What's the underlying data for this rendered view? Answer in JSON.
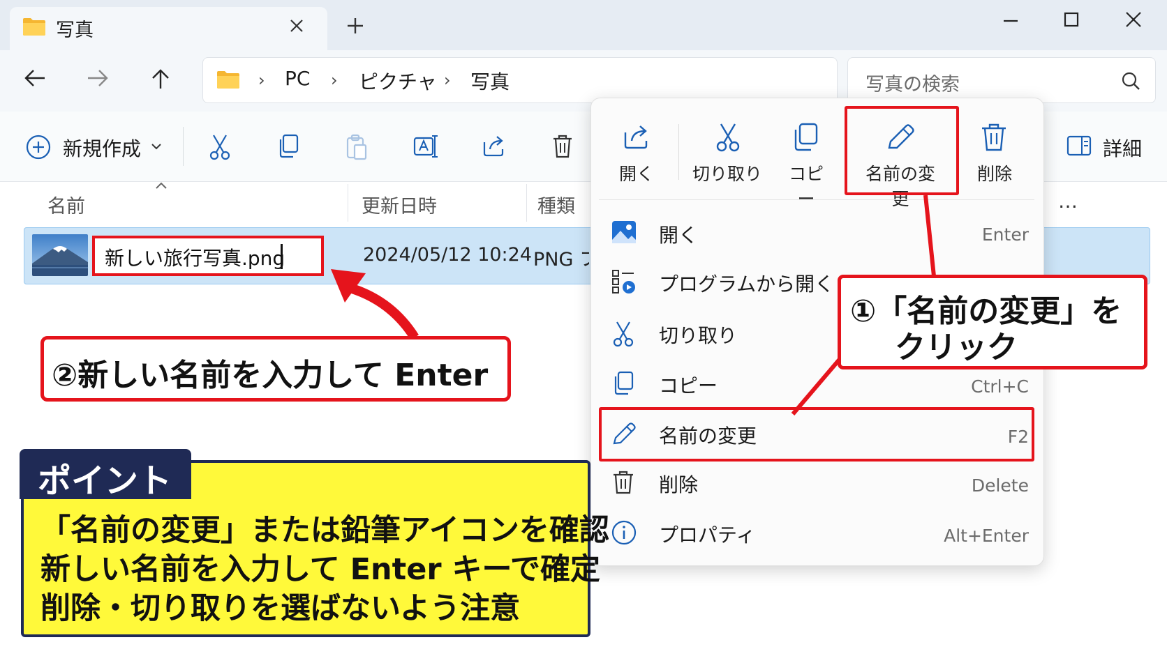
{
  "tab": {
    "title": "写真"
  },
  "window": {
    "minimize": "—",
    "maximize": "☐",
    "close": "✕"
  },
  "address": {
    "crumbs": [
      "PC",
      "ピクチャ",
      "写真"
    ],
    "search_placeholder": "写真の検索"
  },
  "toolbar": {
    "new_label": "新規作成",
    "details_label": "詳細",
    "icons": [
      "scissors-icon",
      "copy-icon",
      "paste-icon",
      "rename-icon",
      "share-icon",
      "trash-icon"
    ]
  },
  "columns": {
    "name": "名前",
    "modified": "更新日時",
    "type": "種類",
    "more": "…"
  },
  "file_row": {
    "name_value": "新しい旅行写真.png",
    "modified": "2024/05/12 10:24",
    "type": "PNG ファイル"
  },
  "context_menu": {
    "top_actions": [
      {
        "label": "開く",
        "icon": "open-share-icon"
      },
      {
        "label": "切り取り",
        "icon": "scissors-icon"
      },
      {
        "label": "コピー",
        "icon": "copy-icon"
      },
      {
        "label": "名前の変更",
        "icon": "pencil-icon"
      },
      {
        "label": "削除",
        "icon": "trash-icon"
      }
    ],
    "items": [
      {
        "label": "開く",
        "shortcut": "Enter",
        "icon": "image-icon"
      },
      {
        "label": "プログラムから開く",
        "shortcut": "",
        "icon": "apps-icon"
      },
      {
        "label": "切り取り",
        "shortcut": "",
        "icon": "scissors-icon"
      },
      {
        "label": "コピー",
        "shortcut": "Ctrl+C",
        "icon": "copy-icon"
      },
      {
        "label": "名前の変更",
        "shortcut": "F2",
        "icon": "pencil-icon"
      },
      {
        "label": "削除",
        "shortcut": "Delete",
        "icon": "trash-icon"
      },
      {
        "label": "プロパティ",
        "shortcut": "Alt+Enter",
        "icon": "info-icon"
      }
    ]
  },
  "annotations": {
    "step1_line1": "①「名前の変更」を",
    "step1_line2": "クリック",
    "step2": "②新しい名前を入力して Enter"
  },
  "point": {
    "tag": "ポイント",
    "lines": [
      "「名前の変更」または鉛筆アイコンを確認",
      "新しい名前を入力して Enter キーで確定",
      "削除・切り取りを選ばないよう注意"
    ]
  },
  "colors": {
    "accent_red": "#e5141c",
    "selection": "#cce4f7",
    "point_bg": "#fff93a",
    "point_navy": "#1f2a55"
  }
}
